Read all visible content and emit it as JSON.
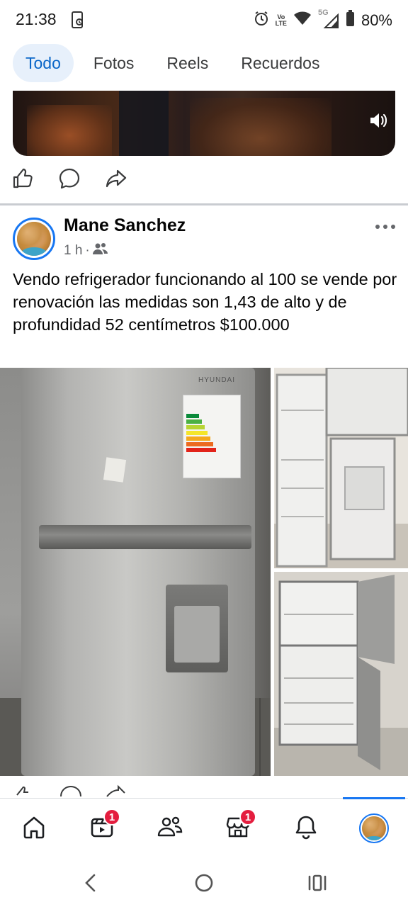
{
  "status_bar": {
    "time": "21:38",
    "battery": "80%",
    "network_label_1": "Vo",
    "network_label_2": "LTE",
    "network_5g": "5G"
  },
  "tabs": [
    {
      "label": "Todo",
      "active": true
    },
    {
      "label": "Fotos",
      "active": false
    },
    {
      "label": "Reels",
      "active": false
    },
    {
      "label": "Recuerdos",
      "active": false
    }
  ],
  "post": {
    "author": "Mane Sanchez",
    "time": "1 h",
    "separator": "·",
    "text": "Vendo refrigerador funcionando al 100 se vende por renovación las medidas son 1,43 de alto y de profundidad 52 centímetros $100.000",
    "brand": "HYUNDAI"
  },
  "bottom_nav": {
    "watch_badge": "1",
    "marketplace_badge": "1"
  },
  "icons": [
    "like-icon",
    "comment-icon",
    "share-icon",
    "sound-icon",
    "more-icon",
    "friends-icon",
    "home-icon",
    "watch-icon",
    "groups-icon",
    "marketplace-icon",
    "bell-icon",
    "back-icon",
    "home-circle-icon",
    "recents-icon"
  ],
  "colors": {
    "accent": "#1877f2",
    "tab_active_bg": "#e7f0fb",
    "badge": "#e41e3f"
  }
}
